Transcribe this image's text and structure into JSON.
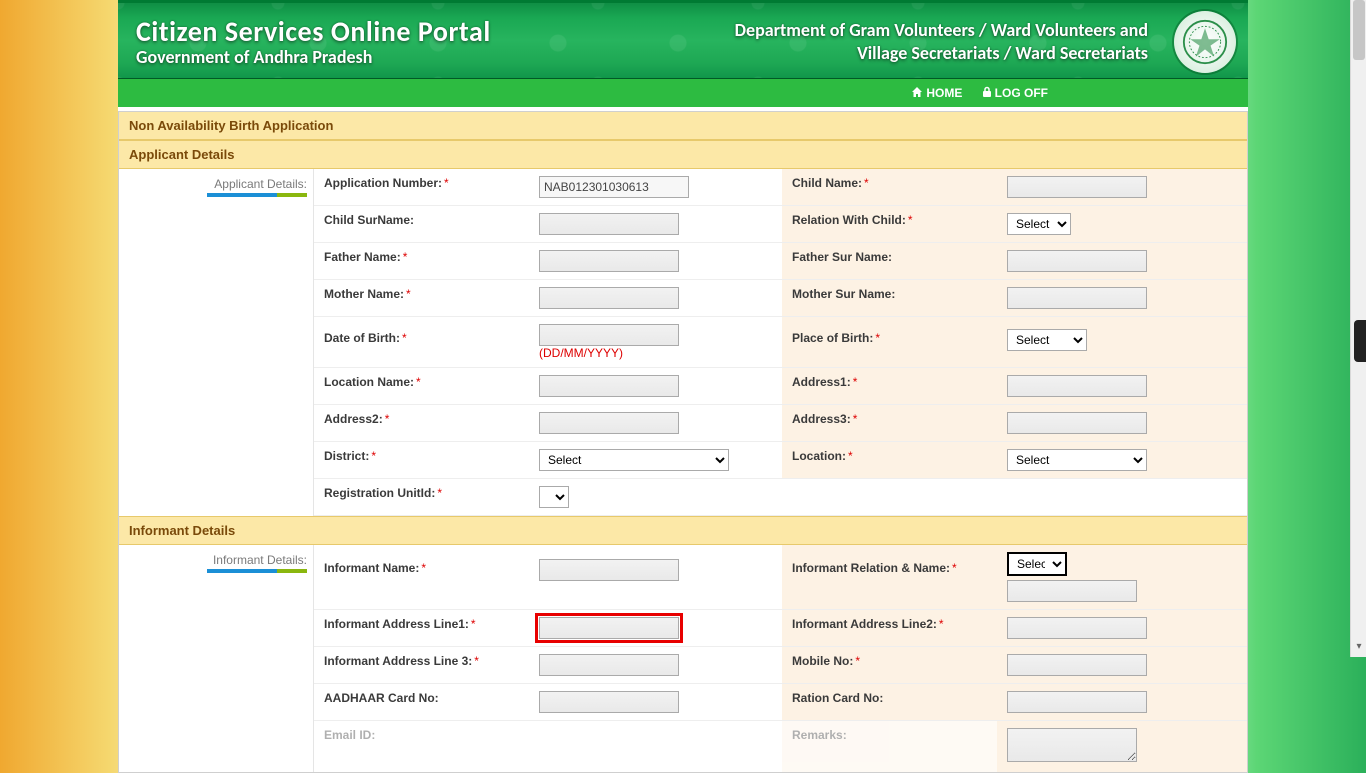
{
  "banner": {
    "title": "Citizen Services Online Portal",
    "gov": "Government of Andhra Pradesh",
    "dept_line1": "Department of Gram Volunteers / Ward Volunteers and",
    "dept_line2": "Village Secretariats / Ward Secretariats"
  },
  "nav": {
    "home": "HOME",
    "logoff": "LOG OFF"
  },
  "sections": {
    "page_title": "Non Availability Birth Application",
    "applicant": "Applicant Details",
    "informant": "Informant Details"
  },
  "side": {
    "applicant": "Applicant Details:",
    "informant": "Informant Details:"
  },
  "applicant": {
    "application_number_label": "Application Number:",
    "application_number_value": "NAB012301030613",
    "child_name_label": "Child Name:",
    "child_surname_label": "Child SurName:",
    "relation_with_child_label": "Relation With Child:",
    "relation_select": "Select",
    "father_name_label": "Father Name:",
    "father_surname_label": "Father Sur Name:",
    "mother_name_label": "Mother Name:",
    "mother_surname_label": "Mother Sur Name:",
    "dob_label": "Date of Birth:",
    "dob_hint": "(DD/MM/YYYY)",
    "place_of_birth_label": "Place of Birth:",
    "place_select": "Select",
    "location_name_label": "Location Name:",
    "address1_label": "Address1:",
    "address2_label": "Address2:",
    "address3_label": "Address3:",
    "district_label": "District:",
    "district_select": "Select",
    "location_label": "Location:",
    "location_select": "Select",
    "registration_unit_label": "Registration UnitId:"
  },
  "informant": {
    "name_label": "Informant Name:",
    "relation_label": "Informant Relation & Name:",
    "relation_select": "Select",
    "addr1_label": "Informant Address Line1:",
    "addr2_label": "Informant Address Line2:",
    "addr3_label": "Informant Address Line 3:",
    "mobile_label": "Mobile No:",
    "aadhaar_label": "AADHAAR Card No:",
    "ration_label": "Ration Card No:",
    "email_label": "Email ID:",
    "remarks_label": "Remarks:"
  }
}
